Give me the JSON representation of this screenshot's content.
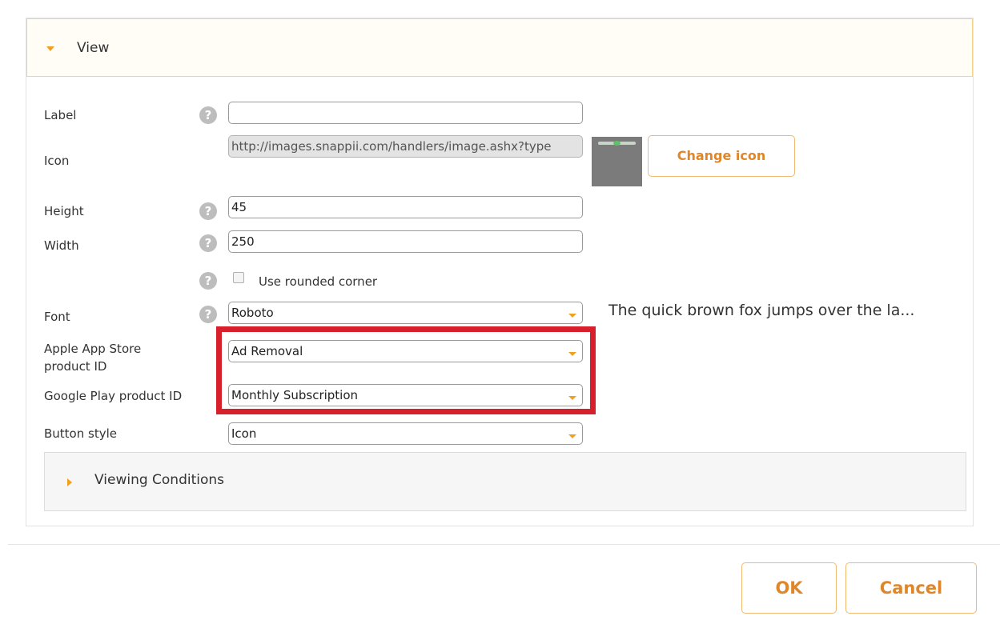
{
  "view_section": {
    "title": "View"
  },
  "form": {
    "label": {
      "label": "Label",
      "value": ""
    },
    "icon": {
      "label": "Icon",
      "url": "http://images.snappii.com/handlers/image.ashx?type",
      "change_button": "Change icon"
    },
    "height": {
      "label": "Height",
      "value": "45"
    },
    "width": {
      "label": "Width",
      "value": "250"
    },
    "rounded_corner": {
      "label": "Use rounded corner",
      "checked": false
    },
    "font": {
      "label": "Font",
      "value": "Roboto",
      "preview": "The quick brown fox jumps over the la..."
    },
    "apple_product": {
      "label_line1": "Apple App Store",
      "label_line2": "product ID",
      "value": "Ad Removal"
    },
    "google_product": {
      "label": "Google Play product ID",
      "value": "Monthly Subscription"
    },
    "button_style": {
      "label": "Button style",
      "value": "Icon"
    },
    "help_glyph": "?"
  },
  "viewing_conditions": {
    "title": "Viewing Conditions"
  },
  "footer": {
    "ok": "OK",
    "cancel": "Cancel"
  },
  "colors": {
    "accent": "#f0a020",
    "highlight": "#d8202c",
    "header_border": "#f2d48a"
  },
  "icons": [
    "caret-down-icon",
    "caret-right-icon",
    "help-icon",
    "dropdown-arrow-icon"
  ]
}
